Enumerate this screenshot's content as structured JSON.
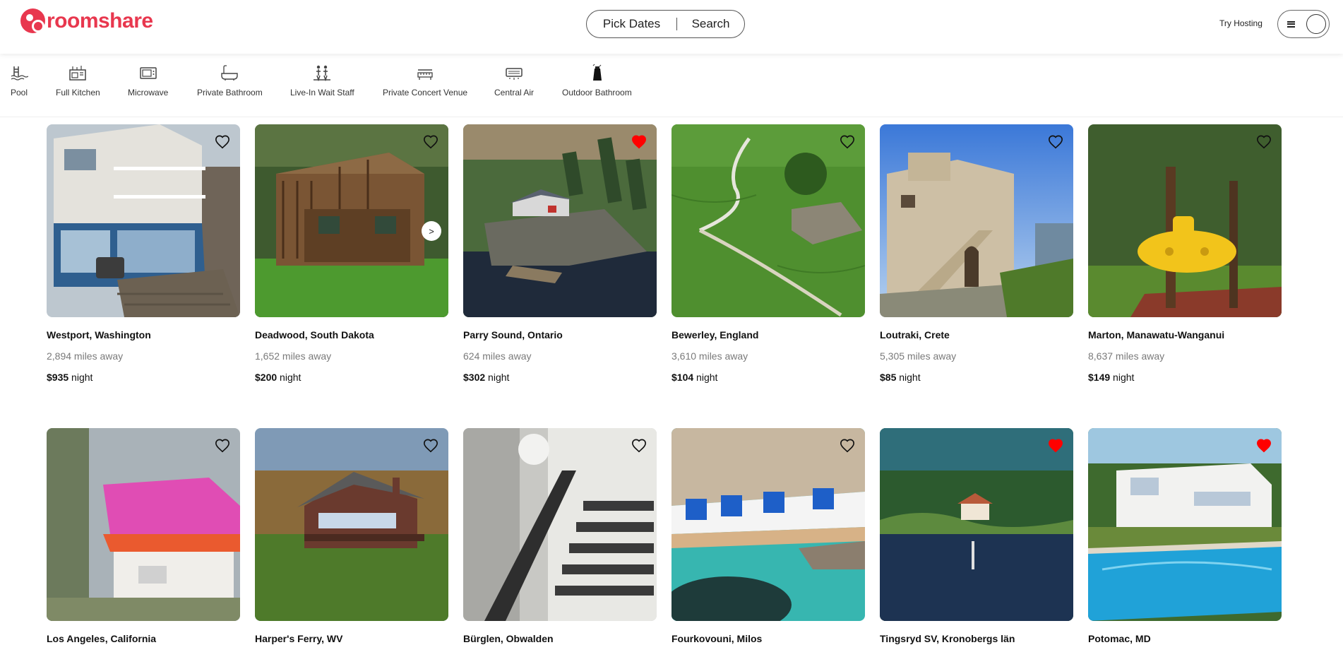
{
  "header": {
    "logo_text": "roomshare",
    "search": {
      "dates_label": "Pick Dates",
      "search_label": "Search"
    },
    "try_hosting": "Try Hosting"
  },
  "categories": [
    {
      "label": "Pool",
      "icon": "pool-icon"
    },
    {
      "label": "Full Kitchen",
      "icon": "kitchen-icon"
    },
    {
      "label": "Microwave",
      "icon": "microwave-icon"
    },
    {
      "label": "Private Bathroom",
      "icon": "bathtub-icon"
    },
    {
      "label": "Live-In Wait Staff",
      "icon": "staff-icon"
    },
    {
      "label": "Private Concert Venue",
      "icon": "piano-icon"
    },
    {
      "label": "Central Air",
      "icon": "air-conditioner-icon"
    },
    {
      "label": "Outdoor Bathroom",
      "icon": "outdoor-shower-icon"
    }
  ],
  "listings": [
    {
      "title": "Westport, Washington",
      "distance": "2,894 miles away",
      "price": "$935",
      "price_unit": " night",
      "favorited": false
    },
    {
      "title": "Deadwood, South Dakota",
      "distance": "1,652 miles away",
      "price": "$200",
      "price_unit": " night",
      "favorited": false,
      "next_label": ">"
    },
    {
      "title": "Parry Sound, Ontario",
      "distance": "624 miles away",
      "price": "$302",
      "price_unit": " night",
      "favorited": true
    },
    {
      "title": "Bewerley, England",
      "distance": "3,610 miles away",
      "price": "$104",
      "price_unit": " night",
      "favorited": false
    },
    {
      "title": "Loutraki, Crete",
      "distance": "5,305 miles away",
      "price": "$85",
      "price_unit": " night",
      "favorited": false
    },
    {
      "title": "Marton, Manawatu-Wanganui",
      "distance": "8,637 miles away",
      "price": "$149",
      "price_unit": " night",
      "favorited": false
    },
    {
      "title": "Los Angeles, California",
      "favorited": false
    },
    {
      "title": "Harper's Ferry, WV",
      "favorited": false
    },
    {
      "title": "Bürglen, Obwalden",
      "favorited": false
    },
    {
      "title": "Fourkovouni, Milos",
      "favorited": false
    },
    {
      "title": "Tingsryd SV, Kronobergs län",
      "favorited": true
    },
    {
      "title": "Potomac, MD",
      "favorited": true
    }
  ],
  "colors": {
    "brand": "#e8374e",
    "favorite": "#ff0000"
  }
}
